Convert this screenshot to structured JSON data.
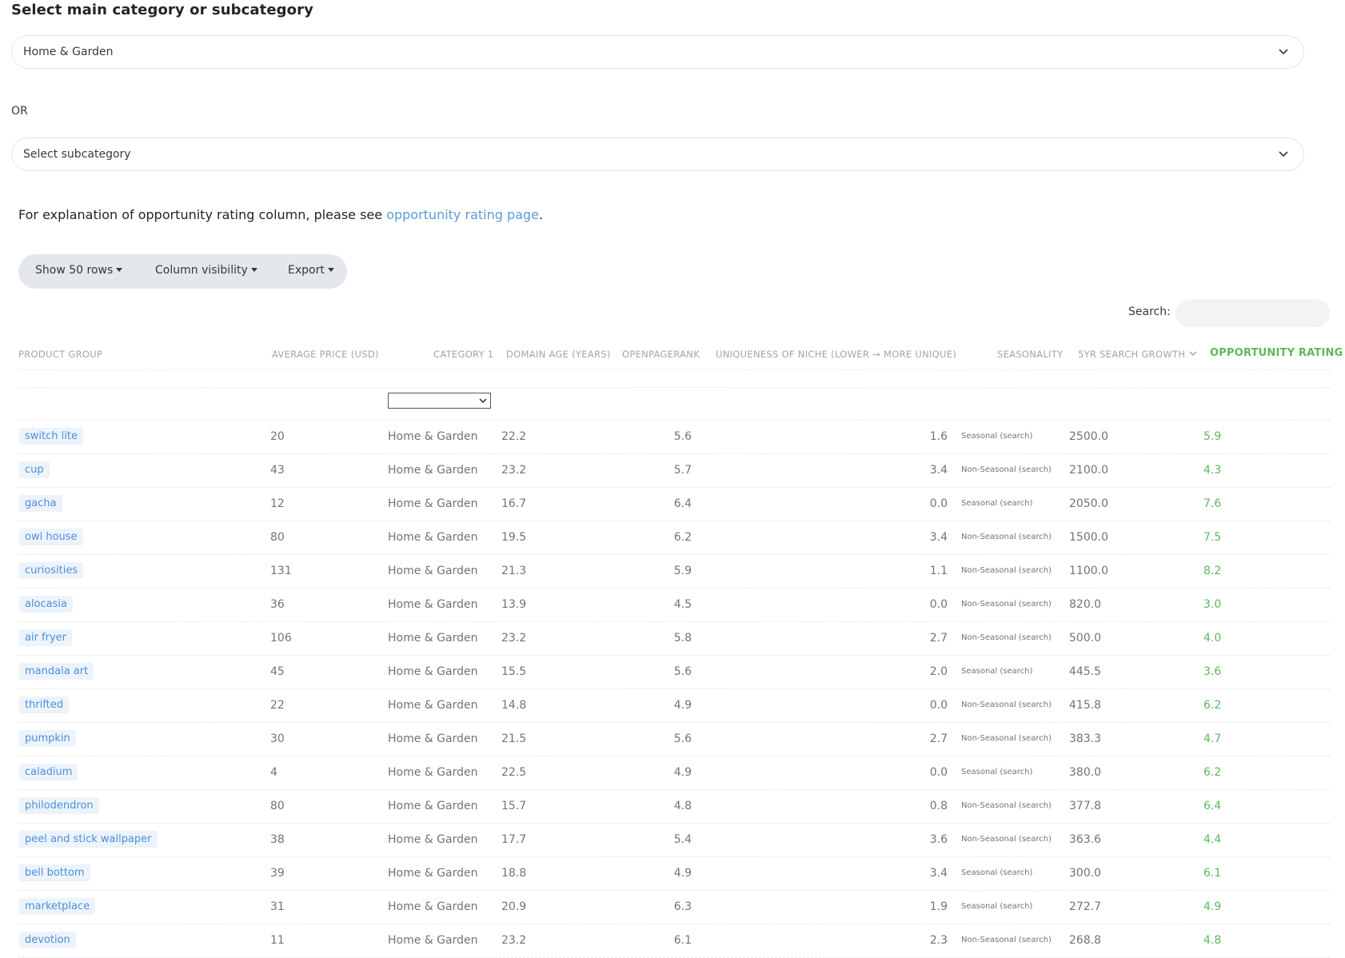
{
  "page": {
    "heading": "Select main category or subcategory",
    "main_select_value": "Home & Garden",
    "or_text": "OR",
    "sub_select_placeholder": "Select subcategory",
    "explain_text": "For explanation of opportunity rating column, please see ",
    "explain_link": "opportunity rating page",
    "explain_end": "."
  },
  "toolbar": {
    "show_rows": "Show 50 rows",
    "column_visibility": "Column visibility",
    "export": "Export"
  },
  "search": {
    "label": "Search:",
    "value": ""
  },
  "columns": {
    "product_group": "PRODUCT GROUP",
    "average_price": "AVERAGE PRICE (USD)",
    "category1": "CATEGORY 1",
    "domain_age": "DOMAIN AGE (YEARS)",
    "openpagerank": "OPENPAGERANK",
    "uniqueness": "UNIQUENESS OF NICHE (LOWER → MORE UNIQUE)",
    "seasonality": "SEASONALITY",
    "growth": "5YR SEARCH GROWTH",
    "opportunity": "OPPORTUNITY RATING"
  },
  "icons": {
    "select_chevron": "chevron-down-icon",
    "sort_indicator": "chevron-down-icon",
    "dropdown_caret": "caret-down-icon"
  },
  "colors": {
    "link_blue": "#5b9bd5",
    "tag_bg": "#edf3fb",
    "tag_text": "#4a90d9",
    "rating_green": "#5cb85c",
    "toolbar_bg": "#e4e7eb"
  },
  "rows": [
    {
      "group": "switch lite",
      "price": "20",
      "category": "Home & Garden",
      "age": "22.2",
      "opr": "5.6",
      "uniq": "1.6",
      "season": "Seasonal (search)",
      "growth": "2500.0",
      "rating": "5.9"
    },
    {
      "group": "cup",
      "price": "43",
      "category": "Home & Garden",
      "age": "23.2",
      "opr": "5.7",
      "uniq": "3.4",
      "season": "Non-Seasonal (search)",
      "growth": "2100.0",
      "rating": "4.3"
    },
    {
      "group": "gacha",
      "price": "12",
      "category": "Home & Garden",
      "age": "16.7",
      "opr": "6.4",
      "uniq": "0.0",
      "season": "Seasonal (search)",
      "growth": "2050.0",
      "rating": "7.6"
    },
    {
      "group": "owl house",
      "price": "80",
      "category": "Home & Garden",
      "age": "19.5",
      "opr": "6.2",
      "uniq": "3.4",
      "season": "Non-Seasonal (search)",
      "growth": "1500.0",
      "rating": "7.5"
    },
    {
      "group": "curiosities",
      "price": "131",
      "category": "Home & Garden",
      "age": "21.3",
      "opr": "5.9",
      "uniq": "1.1",
      "season": "Non-Seasonal (search)",
      "growth": "1100.0",
      "rating": "8.2"
    },
    {
      "group": "alocasia",
      "price": "36",
      "category": "Home & Garden",
      "age": "13.9",
      "opr": "4.5",
      "uniq": "0.0",
      "season": "Non-Seasonal (search)",
      "growth": "820.0",
      "rating": "3.0"
    },
    {
      "group": "air fryer",
      "price": "106",
      "category": "Home & Garden",
      "age": "23.2",
      "opr": "5.8",
      "uniq": "2.7",
      "season": "Non-Seasonal (search)",
      "growth": "500.0",
      "rating": "4.0"
    },
    {
      "group": "mandala art",
      "price": "45",
      "category": "Home & Garden",
      "age": "15.5",
      "opr": "5.6",
      "uniq": "2.0",
      "season": "Seasonal (search)",
      "growth": "445.5",
      "rating": "3.6"
    },
    {
      "group": "thrifted",
      "price": "22",
      "category": "Home & Garden",
      "age": "14.8",
      "opr": "4.9",
      "uniq": "0.0",
      "season": "Non-Seasonal (search)",
      "growth": "415.8",
      "rating": "6.2"
    },
    {
      "group": "pumpkin",
      "price": "30",
      "category": "Home & Garden",
      "age": "21.5",
      "opr": "5.6",
      "uniq": "2.7",
      "season": "Non-Seasonal (search)",
      "growth": "383.3",
      "rating": "4.7"
    },
    {
      "group": "caladium",
      "price": "4",
      "category": "Home & Garden",
      "age": "22.5",
      "opr": "4.9",
      "uniq": "0.0",
      "season": "Seasonal (search)",
      "growth": "380.0",
      "rating": "6.2"
    },
    {
      "group": "philodendron",
      "price": "80",
      "category": "Home & Garden",
      "age": "15.7",
      "opr": "4.8",
      "uniq": "0.8",
      "season": "Non-Seasonal (search)",
      "growth": "377.8",
      "rating": "6.4"
    },
    {
      "group": "peel and stick wallpaper",
      "price": "38",
      "category": "Home & Garden",
      "age": "17.7",
      "opr": "5.4",
      "uniq": "3.6",
      "season": "Non-Seasonal (search)",
      "growth": "363.6",
      "rating": "4.4"
    },
    {
      "group": "bell bottom",
      "price": "39",
      "category": "Home & Garden",
      "age": "18.8",
      "opr": "4.9",
      "uniq": "3.4",
      "season": "Seasonal (search)",
      "growth": "300.0",
      "rating": "6.1"
    },
    {
      "group": "marketplace",
      "price": "31",
      "category": "Home & Garden",
      "age": "20.9",
      "opr": "6.3",
      "uniq": "1.9",
      "season": "Seasonal (search)",
      "growth": "272.7",
      "rating": "4.9"
    },
    {
      "group": "devotion",
      "price": "11",
      "category": "Home & Garden",
      "age": "23.2",
      "opr": "6.1",
      "uniq": "2.3",
      "season": "Non-Seasonal (search)",
      "growth": "268.8",
      "rating": "4.8"
    }
  ]
}
